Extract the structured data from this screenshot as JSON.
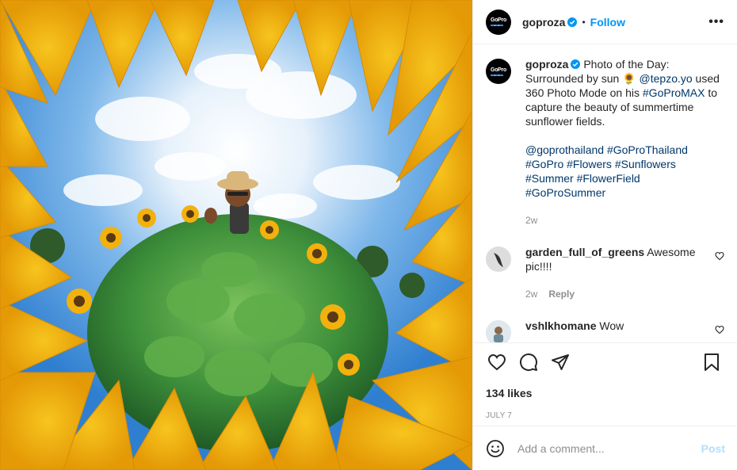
{
  "header": {
    "avatar_text": "GoPro",
    "username": "goproza",
    "separator": "•",
    "follow_label": "Follow",
    "more_label": "•••"
  },
  "caption": {
    "username": "goproza",
    "text_1": "Photo of the Day: Surrounded by sun 🌻 ",
    "mention_1": "@tepzo.yo",
    "text_2": " used 360 Photo Mode on his ",
    "hashtag_1": "#GoProMAX",
    "text_3": " to capture the beauty of summertime sunflower fields.",
    "tags_line": "@goprothailand #GoProThailand #GoPro #Flowers #Sunflowers #Summer #FlowerField #GoProSummer",
    "time": "2w"
  },
  "comments": [
    {
      "username": "garden_full_of_greens",
      "text": "Awesome pic!!!!",
      "time": "2w",
      "reply_label": "Reply"
    },
    {
      "username": "vshlkhomane",
      "text": "Wow"
    }
  ],
  "stats": {
    "likes": "134 likes",
    "date": "JULY 7"
  },
  "add_comment": {
    "placeholder": "Add a comment...",
    "post_label": "Post"
  },
  "colors": {
    "accent": "#0095f6",
    "link": "#00376b",
    "muted": "#8e8e8e",
    "post_disabled": "#b2dffc"
  },
  "icons": {
    "like": "heart-icon",
    "comment": "comment-icon",
    "share": "paper-plane-icon",
    "save": "bookmark-icon",
    "emoji": "smiley-icon",
    "verified": "verified-badge-icon"
  }
}
